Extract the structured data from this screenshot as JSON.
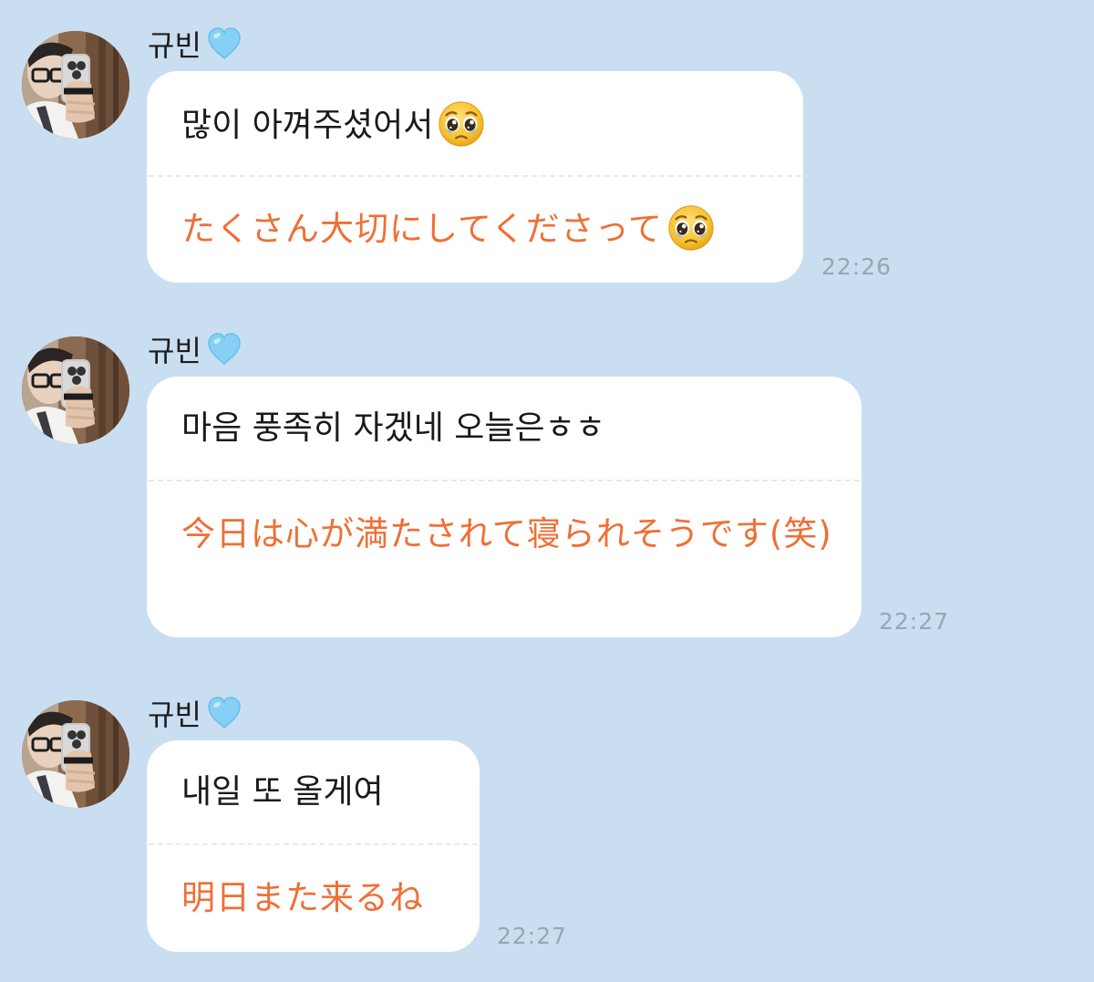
{
  "chat": {
    "background_color": "#cadef2",
    "translation_color": "#ef6f35",
    "messages": [
      {
        "sender": "규빈",
        "sender_icon": "light-blue-heart-icon",
        "text_ko": "많이 아껴주셨어서",
        "text_ja": "たくさん大切にしてくださって",
        "emoji": "pleading-face-icon",
        "time": "22:26"
      },
      {
        "sender": "규빈",
        "sender_icon": "light-blue-heart-icon",
        "text_ko": "마음 풍족히 자겠네 오늘은ㅎㅎ",
        "text_ja": "今日は心が満たされて寝られそうです(笑)",
        "time": "22:27"
      },
      {
        "sender": "규빈",
        "sender_icon": "light-blue-heart-icon",
        "text_ko": "내일 또 올게여",
        "text_ja": "明日また来るね",
        "time": "22:27"
      }
    ]
  }
}
